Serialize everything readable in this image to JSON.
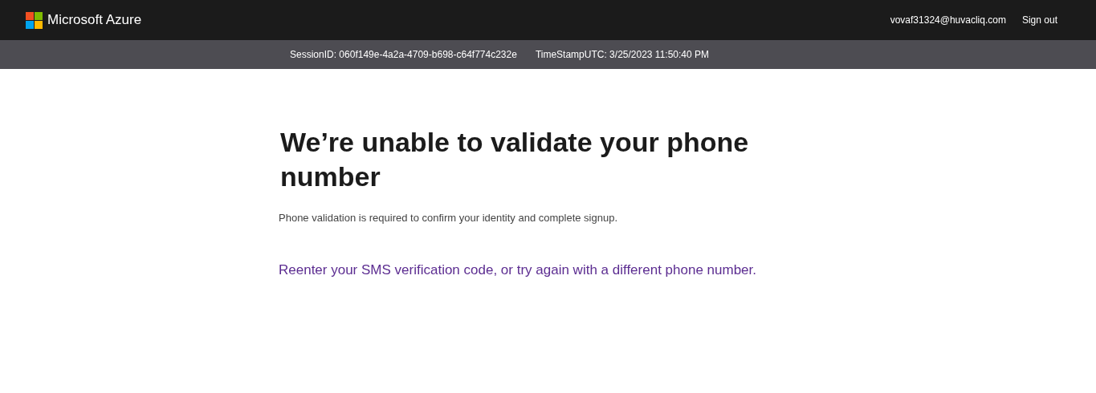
{
  "header": {
    "brand": "Microsoft Azure",
    "user": "vovaf31324@huvacliq.com",
    "sign_out": "Sign out"
  },
  "session_bar": {
    "session_id": "SessionID: 060f149e-4a2a-4709-b698-c64f774c232e",
    "timestamp": "TimeStampUTC: 3/25/2023 11:50:40 PM"
  },
  "content": {
    "title": "We’re unable to validate your phone number",
    "description": "Phone validation is required to confirm your identity and complete signup.",
    "link": "Reenter your SMS verification code, or try again with a different phone number."
  }
}
